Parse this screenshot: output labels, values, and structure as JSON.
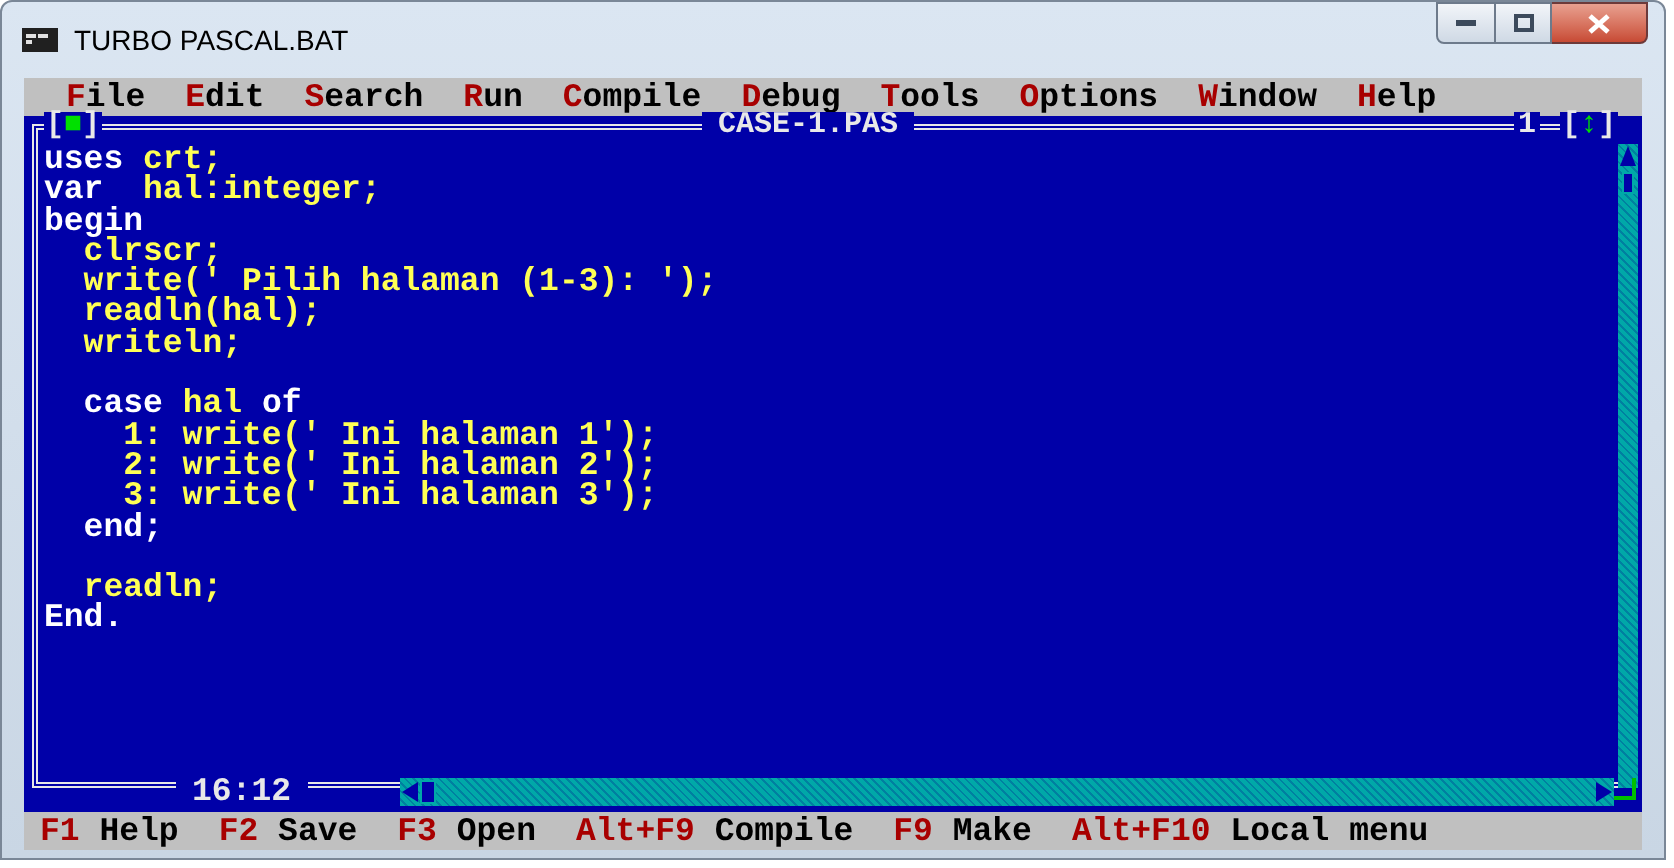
{
  "window": {
    "title": "TURBO PASCAL.BAT"
  },
  "menu": [
    {
      "hotkey": "F",
      "rest": "ile"
    },
    {
      "hotkey": "E",
      "rest": "dit"
    },
    {
      "hotkey": "S",
      "rest": "earch"
    },
    {
      "hotkey": "R",
      "rest": "un"
    },
    {
      "hotkey": "C",
      "rest": "ompile"
    },
    {
      "hotkey": "D",
      "rest": "ebug"
    },
    {
      "hotkey": "T",
      "rest": "ools"
    },
    {
      "hotkey": "O",
      "rest": "ptions"
    },
    {
      "hotkey": "W",
      "rest": "indow"
    },
    {
      "hotkey": "H",
      "rest": "elp"
    }
  ],
  "editor": {
    "close_box": "[■]",
    "file_name": "CASE-1.PAS",
    "window_number": "1",
    "zoom_box": "[↕]",
    "cursor_position": "16:12",
    "lines": [
      {
        "kind": "code",
        "tokens": [
          {
            "kind": "reserved",
            "text": "uses"
          },
          {
            "kind": "plain",
            "text": " crt;"
          }
        ]
      },
      {
        "kind": "code",
        "tokens": [
          {
            "kind": "reserved",
            "text": "var"
          },
          {
            "kind": "plain",
            "text": "  hal:integer;"
          }
        ]
      },
      {
        "kind": "code",
        "tokens": [
          {
            "kind": "reserved",
            "text": "begin"
          }
        ]
      },
      {
        "kind": "code",
        "tokens": [
          {
            "kind": "plain",
            "text": "  clrscr;"
          }
        ]
      },
      {
        "kind": "code",
        "tokens": [
          {
            "kind": "plain",
            "text": "  write(' Pilih halaman (1-3): ');"
          }
        ]
      },
      {
        "kind": "code",
        "tokens": [
          {
            "kind": "plain",
            "text": "  readln(hal);"
          }
        ]
      },
      {
        "kind": "code",
        "tokens": [
          {
            "kind": "plain",
            "text": "  writeln;"
          }
        ]
      },
      {
        "kind": "blank"
      },
      {
        "kind": "code",
        "tokens": [
          {
            "kind": "reserved",
            "text": "  case"
          },
          {
            "kind": "plain",
            "text": " hal "
          },
          {
            "kind": "reserved",
            "text": "of"
          }
        ]
      },
      {
        "kind": "code",
        "tokens": [
          {
            "kind": "plain",
            "text": "    1: write(' Ini halaman 1');"
          }
        ]
      },
      {
        "kind": "code",
        "tokens": [
          {
            "kind": "plain",
            "text": "    2: write(' Ini halaman 2');"
          }
        ]
      },
      {
        "kind": "code",
        "tokens": [
          {
            "kind": "plain",
            "text": "    3: write(' Ini halaman 3');"
          }
        ]
      },
      {
        "kind": "code",
        "tokens": [
          {
            "kind": "reserved",
            "text": "  end;"
          }
        ]
      },
      {
        "kind": "blank"
      },
      {
        "kind": "code",
        "tokens": [
          {
            "kind": "plain",
            "text": "  readln;"
          }
        ]
      },
      {
        "kind": "code",
        "tokens": [
          {
            "kind": "reserved",
            "text": "End."
          }
        ]
      }
    ]
  },
  "status_bar": [
    {
      "key": "F1",
      "label": "Help"
    },
    {
      "key": "F2",
      "label": "Save"
    },
    {
      "key": "F3",
      "label": "Open"
    },
    {
      "key": "Alt+F9",
      "label": "Compile"
    },
    {
      "key": "F9",
      "label": "Make"
    },
    {
      "key": "Alt+F10",
      "label": "Local menu"
    }
  ]
}
